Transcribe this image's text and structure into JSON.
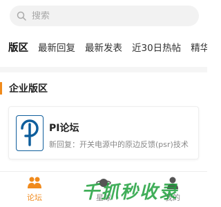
{
  "search": {
    "placeholder": "搜索"
  },
  "tabs": [
    {
      "label": "版区",
      "active": true
    },
    {
      "label": "最新回复",
      "active": false
    },
    {
      "label": "最新发表",
      "active": false
    },
    {
      "label": "近30日热帖",
      "active": false
    },
    {
      "label": "精华",
      "active": false
    }
  ],
  "section": {
    "title": "企业版区"
  },
  "forum": {
    "name": "PI论坛",
    "latest_reply": "新回复：开关电源中的原边反馈(psr)技术"
  },
  "bottom_nav": {
    "forum_label": "论坛",
    "planet_label": "星球",
    "me_label": "我的"
  },
  "watermark": {
    "text": "千抓秒收录"
  },
  "colors": {
    "accent": "#f08a1c",
    "logo_blue": "#0f5e9c"
  }
}
